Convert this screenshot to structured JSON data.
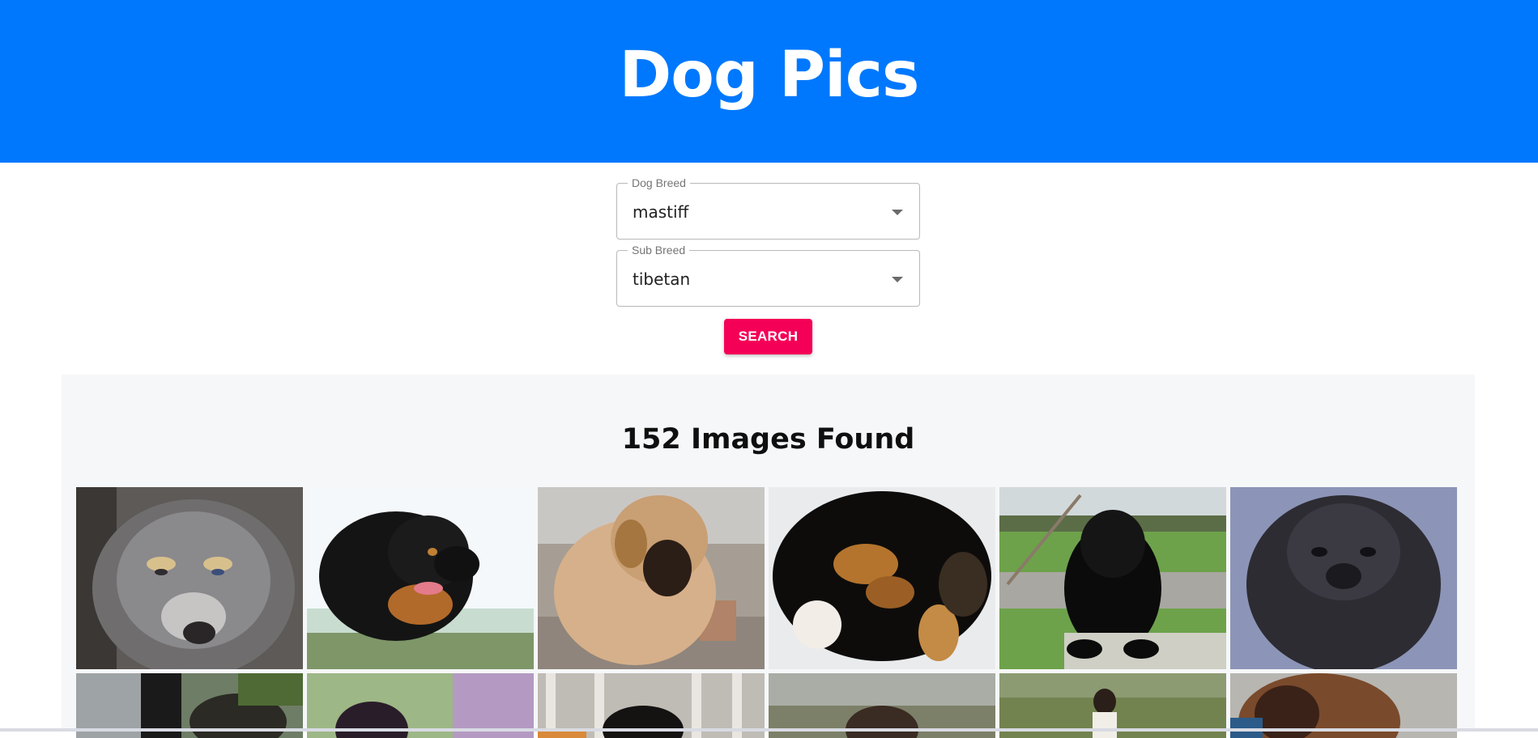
{
  "header": {
    "title": "Dog Pics"
  },
  "breed_select": {
    "label": "Dog Breed",
    "value": "mastiff"
  },
  "sub_breed_select": {
    "label": "Sub Breed",
    "value": "tibetan"
  },
  "search_button": {
    "label": "SEARCH"
  },
  "results": {
    "heading": "152 Images Found"
  },
  "colors": {
    "header_bg": "#0078fd",
    "button_bg": "#f50057",
    "results_bg": "#f6f7f9"
  }
}
